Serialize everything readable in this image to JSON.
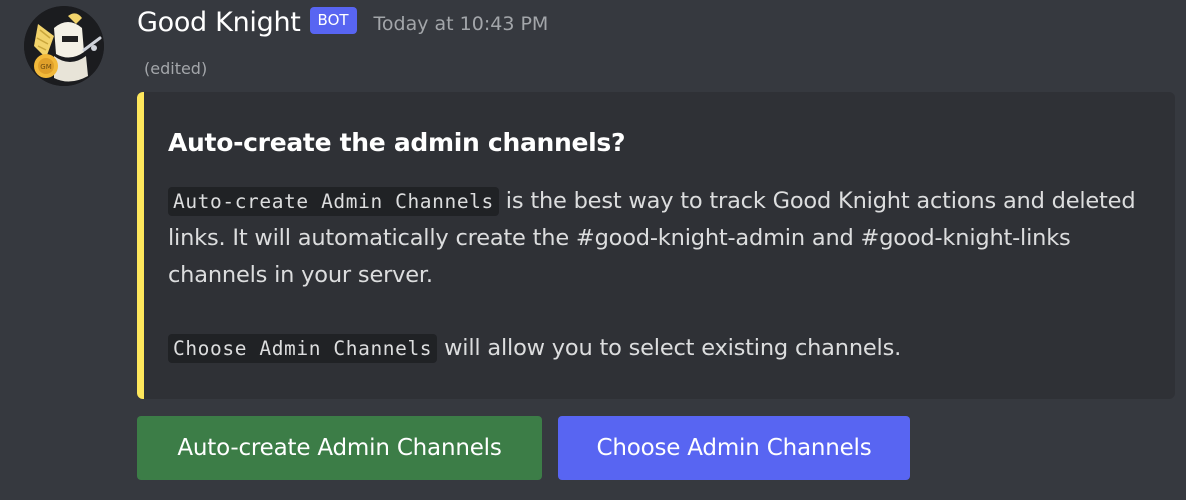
{
  "message": {
    "author": "Good Knight",
    "bot_tag": "BOT",
    "timestamp": "Today at 10:43 PM",
    "edited_label": "(edited)",
    "avatar": "knight-logo-avatar"
  },
  "embed": {
    "accent_color": "#fee75c",
    "title": "Auto-create the admin channels?",
    "paragraph1_code": "Auto-create Admin Channels",
    "paragraph1_text": " is the best way to track Good Knight actions and deleted links. It will automatically create the #good-knight-admin and #good-knight-links channels in your server.",
    "paragraph2_code": "Choose Admin Channels",
    "paragraph2_text": " will allow you to select existing channels."
  },
  "buttons": {
    "auto_create_label": "Auto-create Admin Channels",
    "auto_create_color": "#3c7d47",
    "choose_label": "Choose Admin Channels",
    "choose_color": "#5865f2"
  }
}
